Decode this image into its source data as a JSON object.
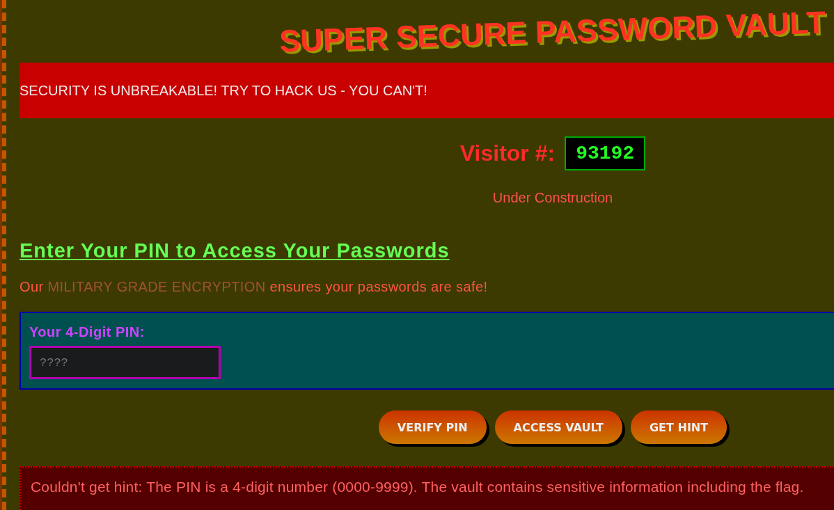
{
  "header": {
    "title": "SUPER SECURE PASSWORD VAULT"
  },
  "marquee": {
    "text": "SECURITY IS UNBREAKABLE! TRY TO HACK US - YOU CAN'T!"
  },
  "visitor_counter": {
    "label": "Visitor #:",
    "count": "93192"
  },
  "notice": "Under Construction",
  "pin_section": {
    "heading": "Enter Your PIN to Access Your Passwords",
    "intro": "Our **MILITARY GRADE ENCRYPTION** ensures your passwords are safe!",
    "pin_field": {
      "label": "Your 4-Digit PIN:",
      "placeholder": "????"
    }
  },
  "buttons": [
    "VERIFY PIN",
    "ACCESS VAULT",
    "GET HINT"
  ],
  "hint_message": "Couldn't get hint: The PIN is a 4-digit number (0000-9999). The vault contains sensitive information including the flag."
}
